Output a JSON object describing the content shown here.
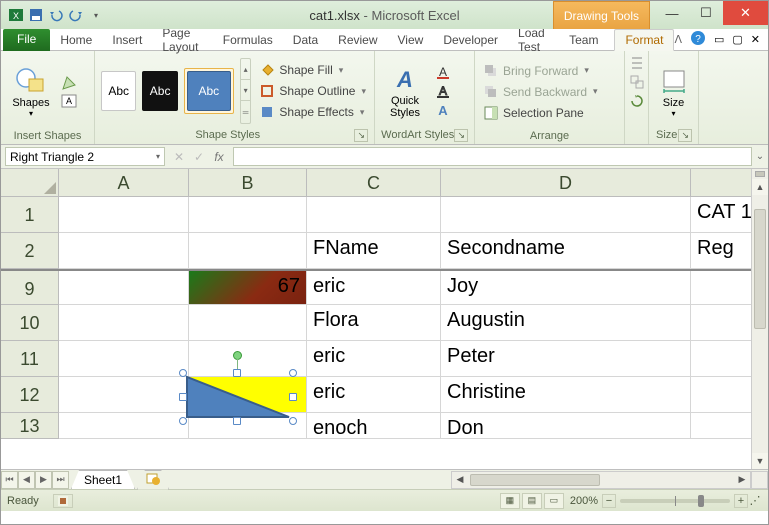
{
  "title": {
    "doc": "cat1.xlsx",
    "app": "Microsoft Excel",
    "context_tool": "Drawing Tools"
  },
  "tabs": {
    "file": "File",
    "items": [
      "Home",
      "Insert",
      "Page Layout",
      "Formulas",
      "Data",
      "Review",
      "View",
      "Developer",
      "Load Test",
      "Team"
    ],
    "format": "Format"
  },
  "ribbon": {
    "insert_shapes": {
      "btn": "Shapes",
      "label": "Insert Shapes"
    },
    "shape_styles": {
      "thumb": "Abc",
      "fill": "Shape Fill",
      "outline": "Shape Outline",
      "effects": "Shape Effects",
      "label": "Shape Styles"
    },
    "wordart": {
      "btn": "Quick\nStyles",
      "label": "WordArt Styles"
    },
    "arrange": {
      "fwd": "Bring Forward",
      "back": "Send Backward",
      "pane": "Selection Pane",
      "label": "Arrange"
    },
    "size": {
      "btn": "Size",
      "label": "Size"
    }
  },
  "fbar": {
    "name": "Right Triangle 2",
    "fx": "fx"
  },
  "columns": [
    "A",
    "B",
    "C",
    "D"
  ],
  "rows": [
    {
      "n": "1",
      "A": "",
      "B": "",
      "C": "",
      "D": "",
      "E": "CAT 1"
    },
    {
      "n": "2",
      "A": "",
      "B": "",
      "C": "FName",
      "D": "Secondname",
      "E": "Reg"
    },
    {
      "n": "9",
      "A": "",
      "B": "67",
      "C": "eric",
      "D": "Joy",
      "E": ""
    },
    {
      "n": "10",
      "A": "",
      "B": "",
      "C": "Flora",
      "D": "Augustin",
      "E": ""
    },
    {
      "n": "11",
      "A": "",
      "B": "",
      "C": "eric",
      "D": "Peter",
      "E": ""
    },
    {
      "n": "12",
      "A": "",
      "B": "",
      "C": "eric",
      "D": "Christine",
      "E": ""
    },
    {
      "n": "13",
      "A": "",
      "B": "",
      "C": "enoch",
      "D": "Don",
      "E": ""
    }
  ],
  "sheet_tab": "Sheet1",
  "status": {
    "ready": "Ready",
    "zoom": "200%"
  }
}
